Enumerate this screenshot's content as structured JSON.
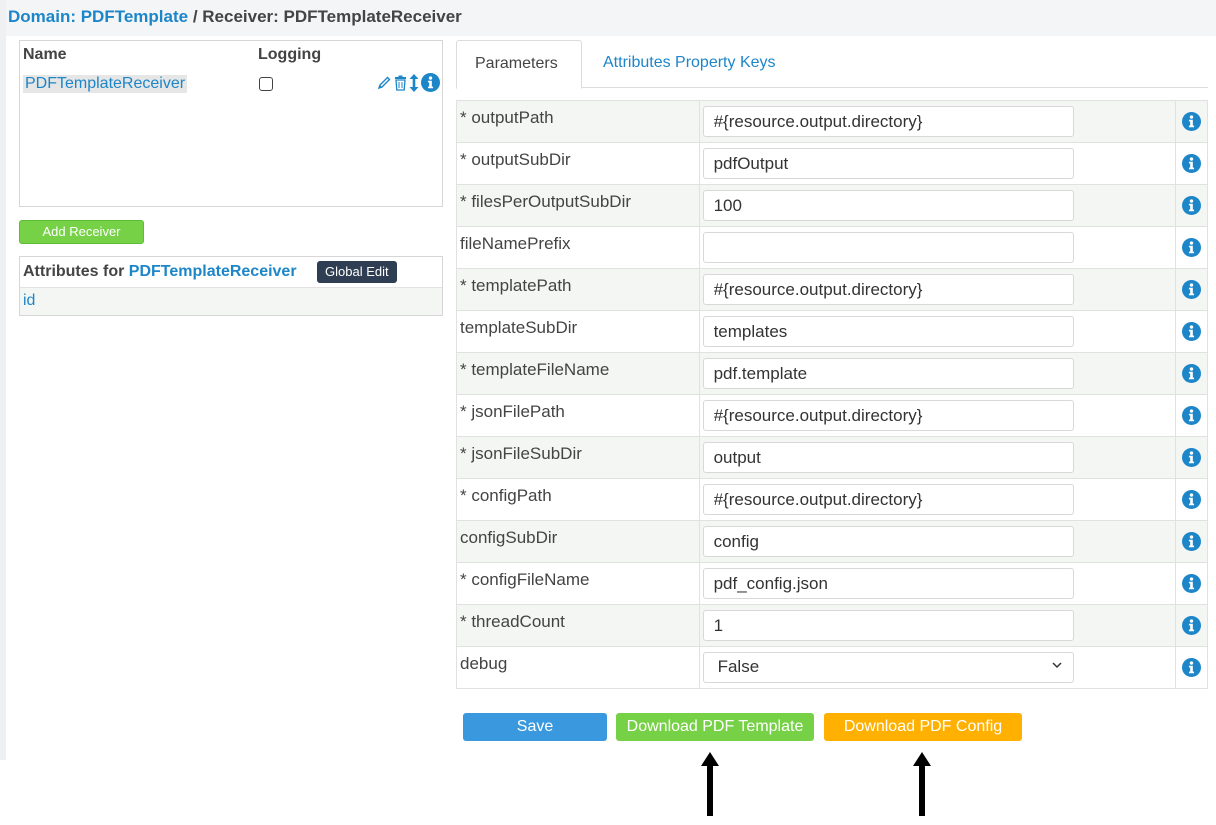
{
  "header": {
    "domain_label": "Domain: PDFTemplate",
    "separator": " / ",
    "receiver_label": "Receiver: PDFTemplateReceiver"
  },
  "receivers": {
    "col_name": "Name",
    "col_logging": "Logging",
    "rows": [
      {
        "name": "PDFTemplateReceiver",
        "logging": false
      }
    ]
  },
  "add_receiver_label": "Add Receiver",
  "attributes": {
    "prefix": "Attributes for ",
    "receiver": "PDFTemplateReceiver",
    "global_edit_label": "Global Edit",
    "items": [
      "id"
    ]
  },
  "tabs": {
    "parameters": "Parameters",
    "attribute_keys": "Attributes Property Keys"
  },
  "params": [
    {
      "label": "* outputPath",
      "value": "#{resource.output.directory}"
    },
    {
      "label": "* outputSubDir",
      "value": "pdfOutput"
    },
    {
      "label": "* filesPerOutputSubDir",
      "value": "100"
    },
    {
      "label": "fileNamePrefix",
      "value": ""
    },
    {
      "label": "* templatePath",
      "value": "#{resource.output.directory}"
    },
    {
      "label": "templateSubDir",
      "value": "templates"
    },
    {
      "label": "* templateFileName",
      "value": "pdf.template"
    },
    {
      "label": "* jsonFilePath",
      "value": "#{resource.output.directory}"
    },
    {
      "label": "* jsonFileSubDir",
      "value": "output"
    },
    {
      "label": "* configPath",
      "value": "#{resource.output.directory}"
    },
    {
      "label": "configSubDir",
      "value": "config"
    },
    {
      "label": "* configFileName",
      "value": "pdf_config.json"
    },
    {
      "label": "* threadCount",
      "value": "1"
    },
    {
      "label": "debug",
      "value": "False",
      "type": "select"
    }
  ],
  "buttons": {
    "save": "Save",
    "download_template": "Download PDF Template",
    "download_config": "Download PDF Config"
  },
  "colors": {
    "link": "#1d86c8",
    "save": "#3a99de",
    "green": "#77d147",
    "orange": "#ffb000",
    "dark": "#2f3e52"
  }
}
